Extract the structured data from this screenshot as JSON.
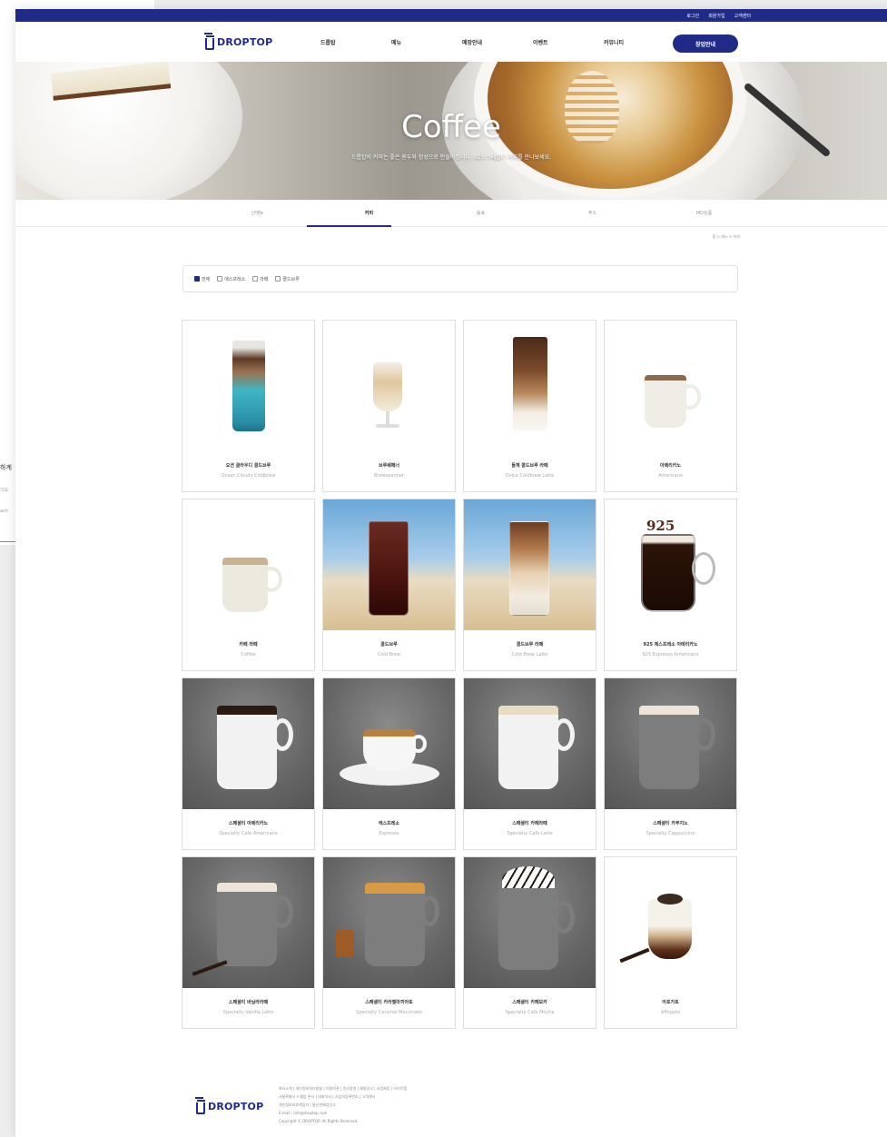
{
  "topbar": {
    "links": [
      "로그인",
      "회원가입",
      "고객센터"
    ]
  },
  "brand": {
    "logo_text": "DROPTOP",
    "primary": "#1f2b87"
  },
  "nav": {
    "items": [
      "드롭탑",
      "메뉴",
      "매장안내",
      "이벤트",
      "커뮤니티"
    ],
    "cta": "창업안내"
  },
  "hero": {
    "title": "Coffee",
    "subtitle": "드롭탑의 커피는 좋은 원두와 정성으로 만들어집니다. 925 스페셜티 커피를 만나보세요."
  },
  "subnav": {
    "items": [
      "신메뉴",
      "커피",
      "음료",
      "푸드",
      "MD상품"
    ],
    "active_index": 1
  },
  "breadcrumb": "홈 > 메뉴 > 커피",
  "filter": {
    "options": [
      {
        "label": "전체",
        "checked": true
      },
      {
        "label": "에스프레소",
        "checked": false
      },
      {
        "label": "라떼",
        "checked": false
      },
      {
        "label": "콜드브루",
        "checked": false
      }
    ]
  },
  "products": [
    {
      "name": "오션 클라우디 콜드브루",
      "en": "Ocean Cloudy Coldbrew"
    },
    {
      "name": "브루쉐페너",
      "en": "Brewspanner"
    },
    {
      "name": "돌체 콜드브루 라떼",
      "en": "Dolce Coldbrew Latte"
    },
    {
      "name": "아메리카노",
      "en": "Americano"
    },
    {
      "name": "카페 라떼",
      "en": "Coffee"
    },
    {
      "name": "콜드브루",
      "en": "Cold Brew"
    },
    {
      "name": "콜드브루 라떼",
      "en": "Cold Brew Latte"
    },
    {
      "name": "925 에스프레소 아메리카노",
      "en": "925 Espresso Americano"
    },
    {
      "name": "스페셜티 아메리카노",
      "en": "Specialty Cafe Americano"
    },
    {
      "name": "에스프레소",
      "en": "Espresso"
    },
    {
      "name": "스페셜티 카페라떼",
      "en": "Specialty Cafe Latte"
    },
    {
      "name": "스페셜티 카푸치노",
      "en": "Specialty Cappuccino"
    },
    {
      "name": "스페셜티 바닐라라떼",
      "en": "Specialty Vanilla Latte"
    },
    {
      "name": "스페셜티 카라멜마끼아또",
      "en": "Specialty Caramel Macchiato"
    },
    {
      "name": "스페셜티 카페모카",
      "en": "Specialty Cafe Mocha"
    },
    {
      "name": "아포가토",
      "en": "Affogato"
    }
  ],
  "footer": {
    "logo_text": "DROPTOP",
    "lines": [
      "회사소개 | 개인정보처리방침 | 이용약관 | 윤리경영 | 채용공고 | 사업제휴 | 사이트맵",
      "서울특별시 드롭탑 본사 | 대표이사 | 사업자등록번호 | 고객센터",
      "개인정보보호책임자 | 통신판매업신고",
      "E-mail : info@droptop.com",
      "Copyright © DROPTOP. All Rights Reserved."
    ]
  }
}
